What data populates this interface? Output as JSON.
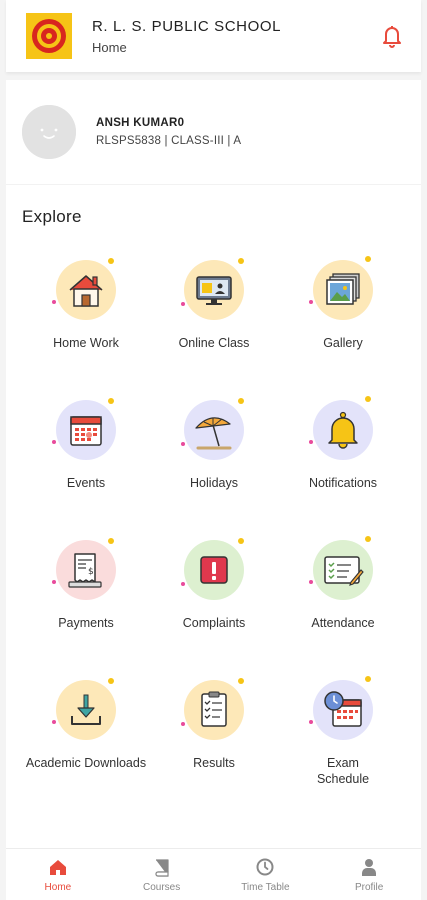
{
  "header": {
    "school_name": "R. L. S. PUBLIC SCHOOL",
    "subtitle": "Home",
    "bell_color": "#e84b3c"
  },
  "profile": {
    "name": "ANSH KUMAR0",
    "meta": "RLSPS5838 | CLASS-III | A"
  },
  "explore": {
    "title": "Explore",
    "items": [
      {
        "label": "Home Work",
        "icon": "house-icon",
        "bg": "#fde8b8"
      },
      {
        "label": "Online Class",
        "icon": "monitor-icon",
        "bg": "#fde8b8"
      },
      {
        "label": "Gallery",
        "icon": "photos-icon",
        "bg": "#fde8b8"
      },
      {
        "label": "Events",
        "icon": "calendar-icon",
        "bg": "#e3e3fa"
      },
      {
        "label": "Holidays",
        "icon": "umbrella-icon",
        "bg": "#e3e3fa"
      },
      {
        "label": "Notifications",
        "icon": "bell-icon",
        "bg": "#e3e3fa"
      },
      {
        "label": "Payments",
        "icon": "receipt-icon",
        "bg": "#fadcdc"
      },
      {
        "label": "Complaints",
        "icon": "alert-icon",
        "bg": "#ddf0d0"
      },
      {
        "label": "Attendance",
        "icon": "checklist-icon",
        "bg": "#ddf0d0"
      },
      {
        "label": "Academic Downloads",
        "icon": "download-icon",
        "bg": "#fde8b8"
      },
      {
        "label": "Results",
        "icon": "results-icon",
        "bg": "#fde8b8"
      },
      {
        "label": "Exam Schedule",
        "icon": "schedule-icon",
        "bg": "#e3e3fa"
      }
    ]
  },
  "nav": {
    "items": [
      {
        "label": "Home",
        "icon": "home-nav-icon",
        "active": true
      },
      {
        "label": "Courses",
        "icon": "book-icon",
        "active": false
      },
      {
        "label": "Time Table",
        "icon": "clock-icon",
        "active": false
      },
      {
        "label": "Profile",
        "icon": "user-icon",
        "active": false
      }
    ],
    "active_color": "#e84b3c",
    "inactive_color": "#888888"
  }
}
